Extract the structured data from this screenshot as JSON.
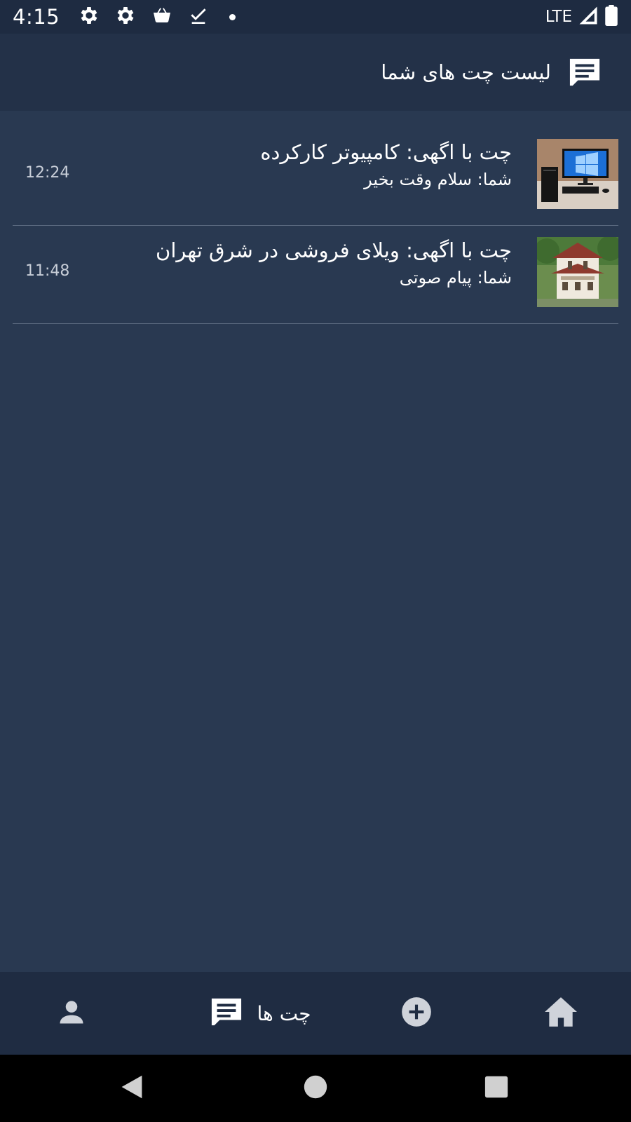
{
  "status_bar": {
    "time": "4:15",
    "network": "LTE",
    "icons": [
      "gear-icon",
      "gear-icon",
      "shopping-bag-icon",
      "download-done-icon",
      "dot-icon",
      "signal-icon",
      "battery-icon"
    ]
  },
  "app_bar": {
    "title": "لیست چت های شما",
    "icon": "chat-icon"
  },
  "chats": [
    {
      "title": "چت با اگهی: کامپیوتر کارکرده",
      "subtitle": "شما: سلام وقت بخیر",
      "time": "12:24",
      "thumbnail": "computer-thumbnail"
    },
    {
      "title": "چت با اگهی: ویلای فروشی در شرق تهران",
      "subtitle": "شما: پیام صوتی",
      "time": "11:48",
      "thumbnail": "villa-thumbnail"
    }
  ],
  "bottom_nav": {
    "chats_label": "چت ها",
    "items": [
      "profile-icon",
      "chat-icon",
      "add-circle-icon",
      "home-icon"
    ]
  },
  "colors": {
    "background": "#293951",
    "app_bar": "#233148",
    "status_bar": "#1e2b41",
    "bottom_nav": "#1f2c42",
    "divider": "#5b6a80"
  }
}
